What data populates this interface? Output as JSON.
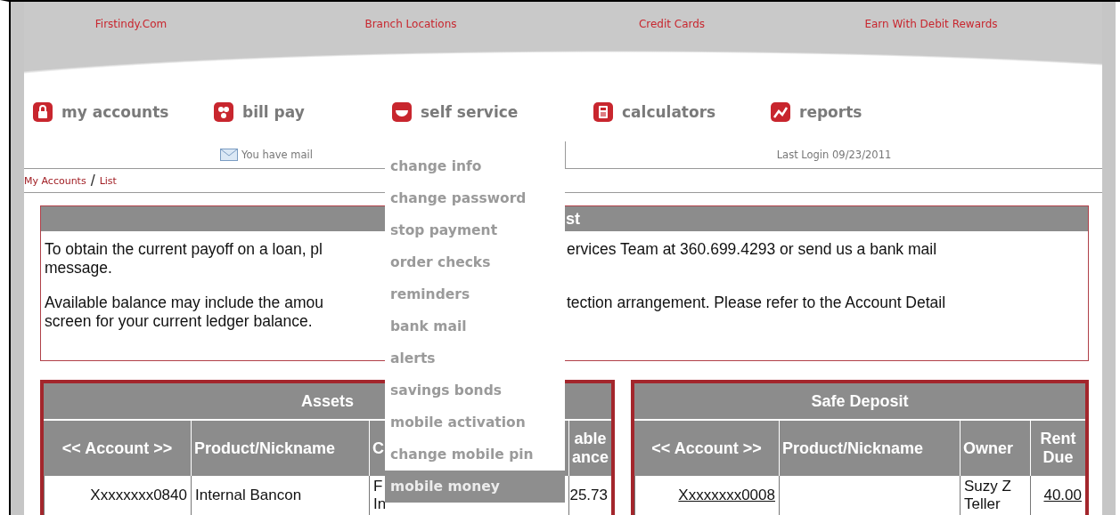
{
  "top_links": [
    "Firstindy.Com",
    "Branch Locations",
    "Credit Cards",
    "Earn With Debit Rewards"
  ],
  "nav": [
    {
      "label": "my accounts"
    },
    {
      "label": "bill pay"
    },
    {
      "label": "self service"
    },
    {
      "label": "calculators"
    },
    {
      "label": "reports"
    }
  ],
  "menu": {
    "items": [
      {
        "label": "change info",
        "selected": false
      },
      {
        "label": "change password",
        "selected": false
      },
      {
        "label": "stop payment",
        "selected": false
      },
      {
        "label": "order checks",
        "selected": false
      },
      {
        "label": "reminders",
        "selected": false
      },
      {
        "label": "bank mail",
        "selected": false
      },
      {
        "label": "alerts",
        "selected": false
      },
      {
        "label": "savings bonds",
        "selected": false
      },
      {
        "label": "mobile activation",
        "selected": false
      },
      {
        "label": "change mobile pin",
        "selected": false
      },
      {
        "label": "mobile money",
        "selected": true
      }
    ]
  },
  "status": {
    "mail": "You have mail",
    "last_login": "Last Login 09/23/2011"
  },
  "breadcrumb": {
    "items": [
      "My Accounts",
      "List"
    ],
    "separator": "/"
  },
  "notice": {
    "heading": "st",
    "paragraphs": [
      {
        "left": [
          "To obtain the current payoff on a loan, pl",
          "message."
        ],
        "right": [
          "ervices Team at 360.699.4293 or send us a bank mail"
        ]
      },
      {
        "left": [
          "Available balance may include the amou",
          "screen for your current ledger balance."
        ],
        "right": [
          "tection arrangement. Please refer to the Account Detail"
        ]
      }
    ]
  },
  "assets": {
    "title": "Assets",
    "columns": [
      {
        "lines": [
          "<< Account >>"
        ]
      },
      {
        "lines": [
          "Product/Nickname"
        ]
      },
      {
        "lines": [
          "C"
        ]
      },
      {
        "lines": [
          "able",
          "ance"
        ]
      }
    ],
    "rows": [
      {
        "cells": [
          {
            "kind": "text",
            "lines": [
              "Xxxxxxxx0840"
            ]
          },
          {
            "kind": "text",
            "lines": [
              "Internal Bancon"
            ]
          },
          {
            "kind": "text",
            "lines": [
              "F",
              "In"
            ]
          },
          {
            "kind": "text",
            "lines": [
              "25.73"
            ]
          }
        ]
      }
    ]
  },
  "safe_deposit": {
    "title": "Safe Deposit",
    "columns": [
      {
        "lines": [
          "<< Account >>"
        ]
      },
      {
        "lines": [
          "Product/Nickname"
        ]
      },
      {
        "lines": [
          "Owner"
        ]
      },
      {
        "lines": [
          "Rent",
          "Due"
        ]
      }
    ],
    "rows": [
      {
        "cells": [
          {
            "kind": "link",
            "lines": [
              "Xxxxxxxx0008"
            ]
          },
          null,
          {
            "kind": "text",
            "lines": [
              "Suzy Z",
              "Teller"
            ]
          },
          {
            "kind": "link",
            "lines": [
              "40.00"
            ]
          }
        ]
      }
    ]
  }
}
